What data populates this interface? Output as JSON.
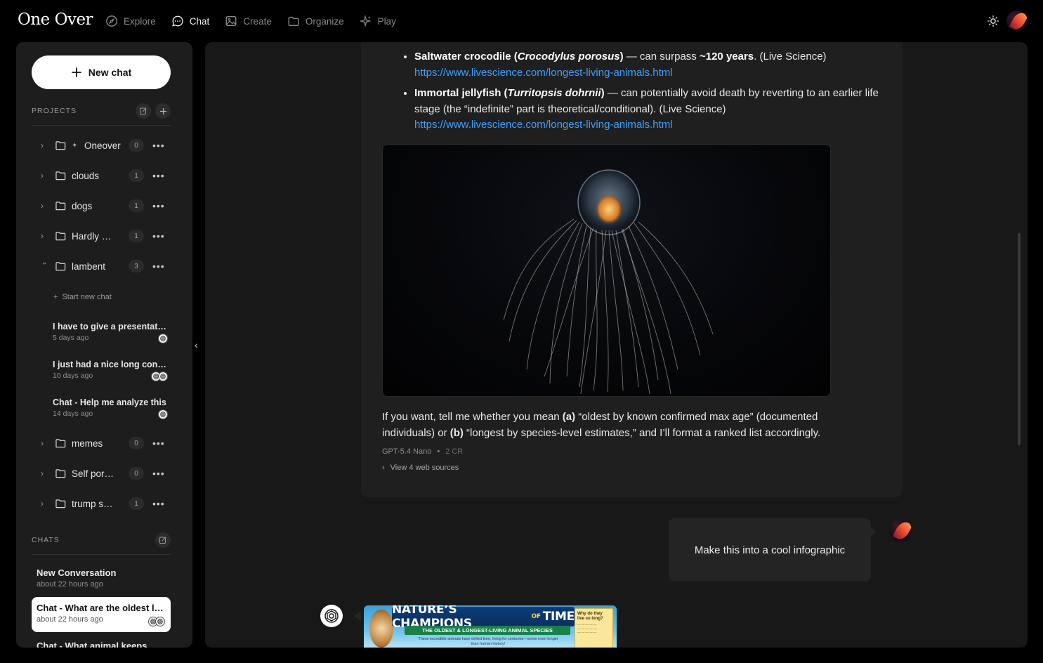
{
  "app": {
    "logo": "One Over",
    "nav": [
      {
        "label": "Explore",
        "icon": "compass-icon"
      },
      {
        "label": "Chat",
        "icon": "chat-bubble-icon"
      },
      {
        "label": "Create",
        "icon": "image-icon"
      },
      {
        "label": "Organize",
        "icon": "folder-icon"
      },
      {
        "label": "Play",
        "icon": "sparkle-icon"
      }
    ],
    "active_nav": "Chat"
  },
  "sidebar": {
    "new_chat_label": "New chat",
    "projects_heading": "PROJECTS",
    "projects": [
      {
        "name": "Oneover",
        "count": "0",
        "pinned": true,
        "expanded": false
      },
      {
        "name": "clouds",
        "count": "1",
        "pinned": false,
        "expanded": false
      },
      {
        "name": "dogs",
        "count": "1",
        "pinned": false,
        "expanded": false
      },
      {
        "name": "Hardly working",
        "count": "1",
        "pinned": false,
        "expanded": false
      },
      {
        "name": "lambent",
        "count": "3",
        "pinned": false,
        "expanded": true
      },
      {
        "name": "memes",
        "count": "0",
        "pinned": false,
        "expanded": false
      },
      {
        "name": "Self portraits",
        "count": "0",
        "pinned": false,
        "expanded": false
      },
      {
        "name": "trump stuff",
        "count": "1",
        "pinned": false,
        "expanded": false
      }
    ],
    "start_new_chat": "Start new chat",
    "project_chats": [
      {
        "title": "I have to give a presentation",
        "date": "5 days ago",
        "models": 1
      },
      {
        "title": "I just had a nice long conversation",
        "date": "10 days ago",
        "models": 2
      },
      {
        "title": "Chat - Help me analyze this",
        "date": "14 days ago",
        "models": 1
      }
    ],
    "chats_heading": "CHATS",
    "chats": [
      {
        "title": "New Conversation",
        "date": "about 22 hours ago",
        "active": false
      },
      {
        "title": "Chat - What are the oldest living animals",
        "date": "about 22 hours ago",
        "active": true
      },
      {
        "title": "Chat - What animal keeps",
        "date": "",
        "active": false
      }
    ]
  },
  "conversation": {
    "bullets": [
      {
        "name": "Saltwater crocodile",
        "latin": "Crocodylus porosus",
        "text_a": " — can surpass ",
        "emph": "~120 years",
        "text_b": ". (Live Science)",
        "link": "https://www.livescience.com/longest-living-animals.html"
      },
      {
        "name": "Immortal jellyfish",
        "latin": "Turritopsis dohrnii",
        "text_a": " — can potentially avoid death by reverting to an earlier life stage (the “indefinite” part is theoretical/conditional). (Live Science)",
        "emph": "",
        "text_b": "",
        "link": "https://www.livescience.com/longest-living-animals.html"
      }
    ],
    "closing_para": {
      "p1": "If you want, tell me whether you mean ",
      "a": "(a)",
      "p2": " “oldest by known confirmed max age” (documented individuals) or ",
      "b": "(b)",
      "p3": " “longest by species-level estimates,” and I’ll format a ranked list accordingly."
    },
    "model": "GPT-5.4 Nano",
    "credits": "2 CR",
    "sources_label": "View 4 web sources",
    "user_message": "Make this into a cool infographic",
    "infographic": {
      "title_a": "NATURE’S CHAMPIONS",
      "title_of": "OF",
      "title_b": "TIME",
      "subtitle": "THE OLDEST & LONGEST-LIVING ANIMAL SPECIES",
      "tagline": "These incredible animals have defied time, living for centuries—some even longer than human history!",
      "note_q": "Why do they live so long?"
    }
  },
  "colors": {
    "accent_link": "#3ea0ff",
    "background": "#000000",
    "panel": "#1d1d1d"
  }
}
